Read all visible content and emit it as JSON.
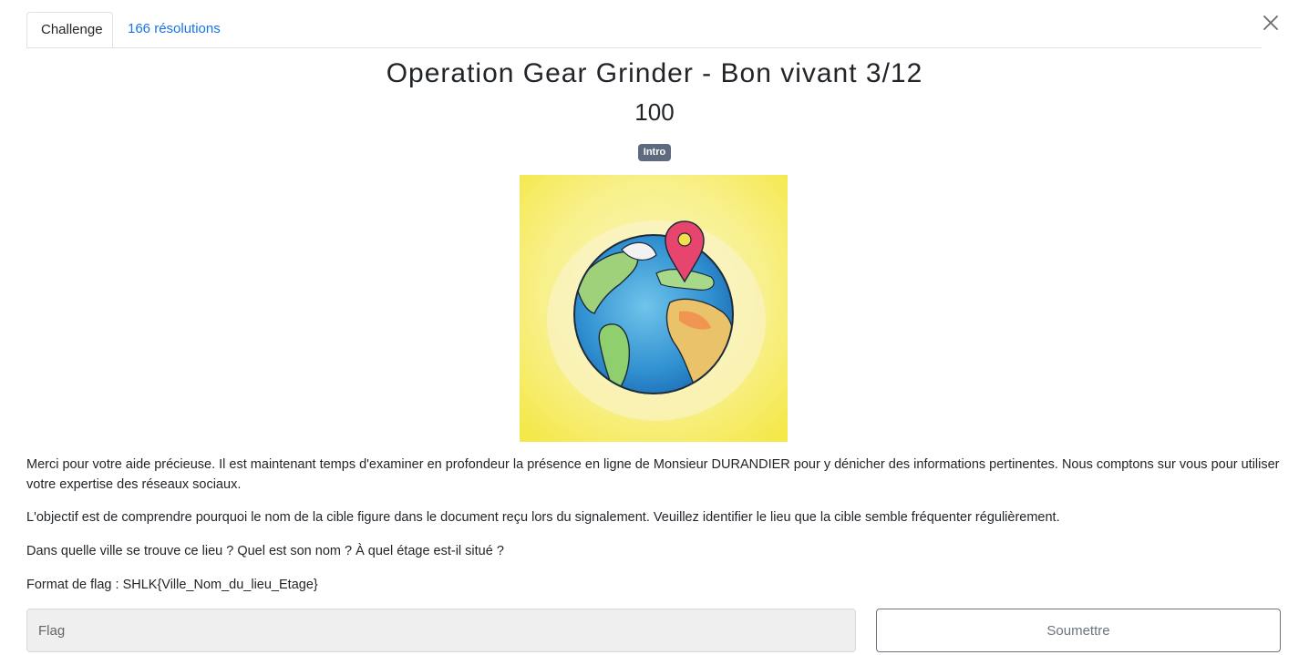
{
  "tabs": [
    {
      "label": "Challenge",
      "active": true
    },
    {
      "label": "166 résolutions",
      "active": false
    }
  ],
  "close_icon": "close-icon",
  "challenge": {
    "title": "Operation Gear Grinder - Bon vivant 3/12",
    "points": "100",
    "category_badge": "Intro",
    "image_icon": "globe-with-location-pin-illustration",
    "description": [
      "Merci pour votre aide précieuse. Il est maintenant temps d'examiner en profondeur la présence en ligne de Monsieur DURANDIER pour y dénicher des informations pertinentes. Nous comptons sur vous pour utiliser votre expertise des réseaux sociaux.",
      "L'objectif est de comprendre pourquoi le nom de la cible figure dans le document reçu lors du signalement. Veuillez identifier le lieu que la cible semble fréquenter régulièrement.",
      "Dans quelle ville se trouve ce lieu ? Quel est son nom ? À quel étage est-il situé ?",
      "Format de flag : SHLK{Ville_Nom_du_lieu_Etage}"
    ]
  },
  "form": {
    "flag_placeholder": "Flag",
    "flag_value": "",
    "submit_label": "Soumettre"
  },
  "colors": {
    "link": "#1a73e8",
    "badge": "#5e6a7d",
    "input_bg": "#efefef",
    "button_border": "#6c757d",
    "illustration_bg": "#f7ef7a"
  }
}
